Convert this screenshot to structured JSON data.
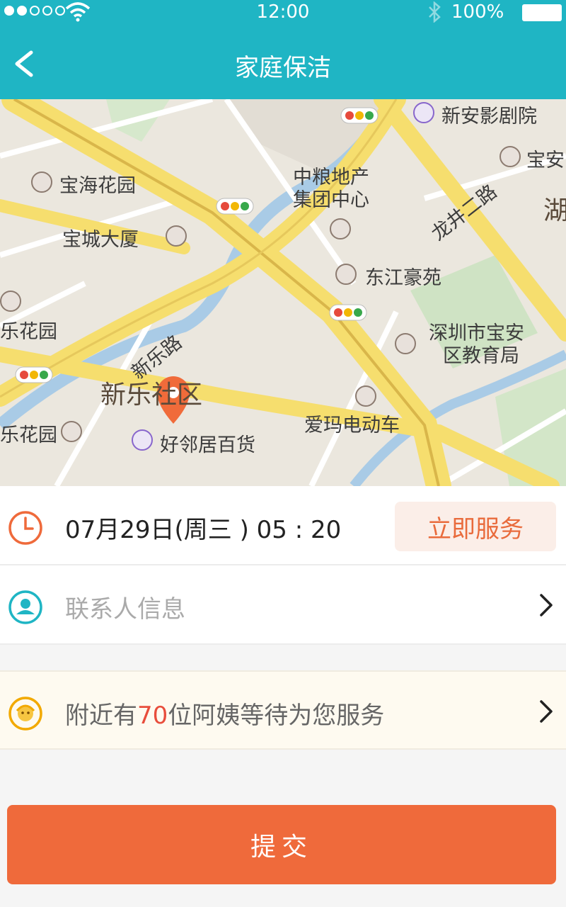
{
  "status_bar": {
    "time": "12:00",
    "battery": "100%"
  },
  "nav": {
    "title": "家庭保洁"
  },
  "map": {
    "labels": {
      "xinan_theater": "新安影剧院",
      "baohai_garden": "宝海花园",
      "zhongliang_1": "中粮地产",
      "zhongliang_2": "集团中心",
      "baocheng": "宝城大厦",
      "longjing": "龙井二路",
      "dongjiang": "东江豪苑",
      "education_1": "深圳市宝安",
      "education_2": "区教育局",
      "xinle_road": "新乐路",
      "xinle_community": "新乐社区",
      "aima": "爱玛电动车",
      "haolinju": "好邻居百货",
      "garden_left_1": "乐花园",
      "garden_left_2": "乐花园",
      "bao_an_right": "宝安",
      "hu": "湖"
    }
  },
  "time_row": {
    "datetime": "07月29日(周三 ) 05 : 20",
    "service_button": "立即服务"
  },
  "contact_row": {
    "placeholder": "联系人信息"
  },
  "nearby_row": {
    "prefix": "附近有",
    "count": "70",
    "suffix": "位阿姨等待为您服务"
  },
  "submit": {
    "label": "提交"
  },
  "colors": {
    "primary": "#1fb5c4",
    "accent": "#ef6a3b",
    "highlight": "#e84d3c"
  }
}
